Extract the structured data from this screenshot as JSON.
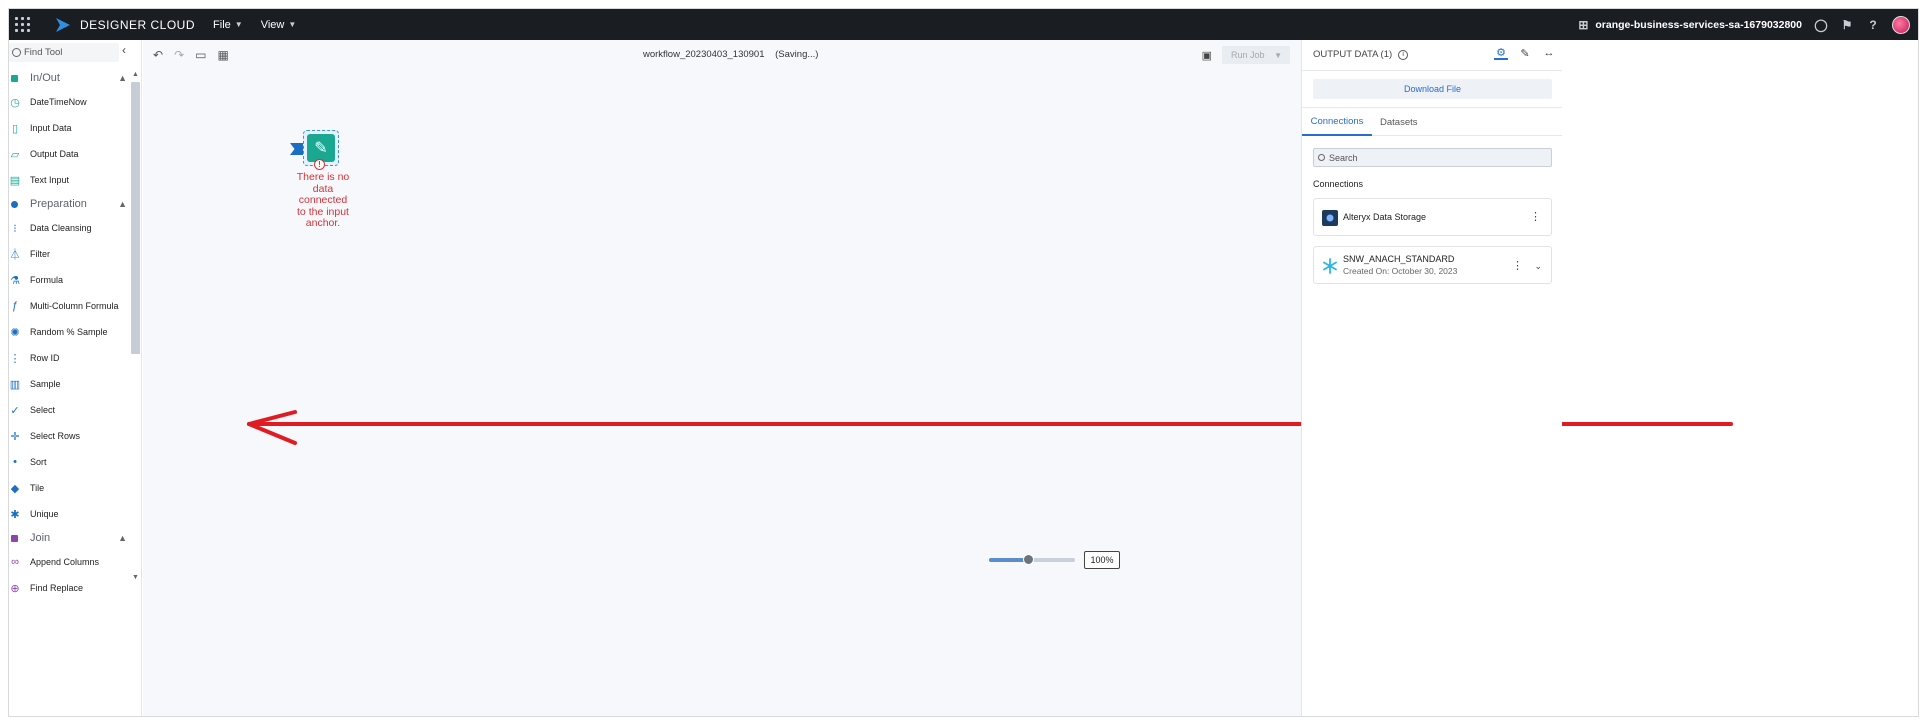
{
  "topbar": {
    "brand": "DESIGNER CLOUD",
    "menus": [
      "File",
      "View"
    ],
    "org": "orange-business-services-sa-1679032800"
  },
  "tools_panel": {
    "search_placeholder": "Find Tool",
    "sections": [
      {
        "label": "In/Out",
        "color": "#1aa893",
        "tools": [
          "DateTimeNow",
          "Input Data",
          "Output Data",
          "Text Input"
        ]
      },
      {
        "label": "Preparation",
        "color": "#1b6ec2",
        "tools": [
          "Data Cleansing",
          "Filter",
          "Formula",
          "Multi-Column Formula",
          "Random % Sample",
          "Row ID",
          "Sample",
          "Select",
          "Select Rows",
          "Sort",
          "Tile",
          "Unique"
        ]
      },
      {
        "label": "Join",
        "color": "#8e44ad",
        "tools": [
          "Append Columns",
          "Find Replace"
        ]
      }
    ]
  },
  "canvas": {
    "workflow_name": "workflow_20230403_130901",
    "status": "(Saving...)",
    "run_job_label": "Run Job",
    "node_error": "There is no data connected to the input anchor.",
    "zoom_level": "100%",
    "zoom_fraction": 0.45
  },
  "right_panel": {
    "title": "OUTPUT DATA (1)",
    "download_label": "Download File",
    "tabs": [
      "Connections",
      "Datasets"
    ],
    "search_placeholder": "Search",
    "connections_label": "Connections",
    "connections": [
      {
        "name": "Alteryx Data Storage",
        "subtitle": ""
      },
      {
        "name": "SNW_ANACH_STANDARD",
        "subtitle": "Created On: October 30, 2023"
      }
    ]
  },
  "colors": {
    "accent": "#2a6cd1",
    "error": "#d0343a",
    "annotation_arrow": "#e01b22"
  }
}
